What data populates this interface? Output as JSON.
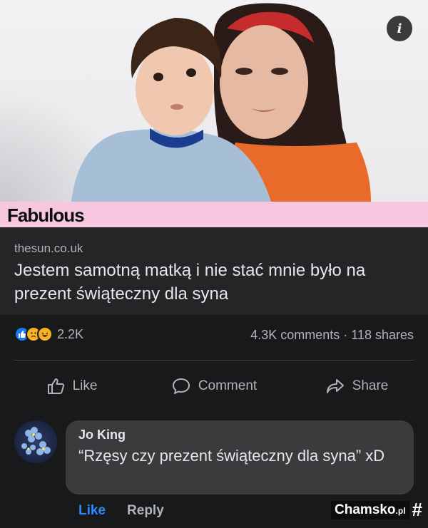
{
  "post": {
    "info_icon": "i",
    "brand": "Fabulous",
    "domain": "thesun.co.uk",
    "headline": "Jestem samotną matką i nie stać mnie było na prezent świąteczny dla syna"
  },
  "stats": {
    "reaction_icons": [
      "like-icon",
      "sad-icon",
      "haha-icon"
    ],
    "reaction_count": "2.2K",
    "comments_shares": "4.3K comments · 118 shares"
  },
  "actions": {
    "like": "Like",
    "comment": "Comment",
    "share": "Share"
  },
  "comment": {
    "author": "Jo King",
    "text": "“Rzęsy czy prezent świąteczny dla syna” xD",
    "like": "Like",
    "reply": "Reply"
  },
  "watermark": {
    "name": "Chamsko",
    "suffix": ".pl",
    "hash": "#"
  },
  "colors": {
    "background": "#18191a",
    "link_block": "#242526",
    "brand_bar": "#f7c7df",
    "accent": "#2d88ff",
    "muted_text": "#b0b3b8"
  }
}
